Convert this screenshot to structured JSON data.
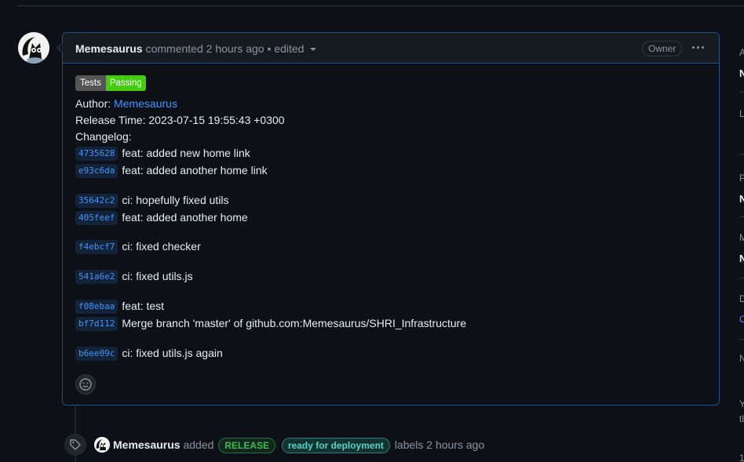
{
  "comment": {
    "author": "Memesaurus",
    "action": "commented",
    "time": "2 hours ago",
    "separator": "•",
    "edited": "edited",
    "role_badge": "Owner",
    "status_badge": {
      "label": "Tests",
      "status": "Passing",
      "label_color": "#555555",
      "status_color": "#44cc11"
    },
    "author_line_label": "Author:",
    "author_line_value": "Memesaurus",
    "release_time_line": "Release Time: 2023-07-15 19:55:43 +0300",
    "changelog_title": "Changelog:",
    "commits": [
      {
        "sha": "4735628",
        "message": "feat: added new home link"
      },
      {
        "sha": "e93c6da",
        "message": "feat: added another home link"
      },
      {
        "sha": "35642c2",
        "message": "ci: hopefully fixed utils"
      },
      {
        "sha": "405feef",
        "message": "feat: added another home"
      },
      {
        "sha": "f4ebcf7",
        "message": "ci: fixed checker"
      },
      {
        "sha": "541a6e2",
        "message": "ci: fixed utils.js"
      },
      {
        "sha": "f08ebaa",
        "message": "feat: test"
      },
      {
        "sha": "bf7d112",
        "message": "Merge branch 'master' of github.com:Memesaurus/SHRI_Infrastructure"
      },
      {
        "sha": "b6ee09c",
        "message": "ci: fixed utils.js again"
      }
    ]
  },
  "event": {
    "author": "Memesaurus",
    "action": "added",
    "labels": [
      {
        "name": "RELEASE",
        "color": "#3fb950"
      },
      {
        "name": "ready for deployment",
        "color": "#56d4c4"
      }
    ],
    "suffix": "labels 2 hours ago"
  },
  "sidebar_fragments": [
    "A",
    "N",
    "L",
    "P",
    "N",
    "M",
    "N",
    "D",
    "C",
    "N",
    "Y",
    "tl",
    "1"
  ],
  "colors": {
    "background": "#0d1117",
    "link": "#4493f8",
    "comment_border": "#1f4f8a"
  }
}
